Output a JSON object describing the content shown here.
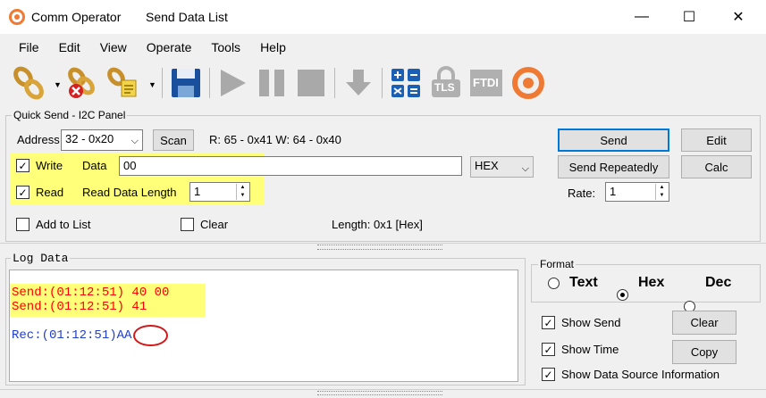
{
  "window": {
    "app_name": "Comm Operator",
    "document": "Send Data List",
    "minimize": "—",
    "maximize": "☐",
    "close": "✕"
  },
  "menu": [
    "File",
    "Edit",
    "View",
    "Operate",
    "Tools",
    "Help"
  ],
  "toolbar": {
    "icons": [
      "connect-icon",
      "disconnect-icon",
      "connection-settings-icon",
      "save-icon",
      "play-icon",
      "pause-icon",
      "stop-icon",
      "download-icon",
      "calculator-icon",
      "tls-icon",
      "ftdi-icon",
      "comm-operator-logo"
    ],
    "tls_label": "TLS",
    "ftdi_label": "FTDI"
  },
  "quick_send": {
    "title": "Quick Send - I2C Panel",
    "address_label": "Address",
    "address_value": "32 - 0x20",
    "scan_label": "Scan",
    "rw_info": "R: 65 - 0x41  W: 64 - 0x40",
    "write_label": "Write",
    "write_checked": true,
    "data_label": "Data",
    "data_value": "00",
    "format_value": "HEX",
    "read_label": "Read",
    "read_checked": true,
    "read_length_label": "Read Data Length",
    "read_length_value": "1",
    "add_to_list_label": "Add to List",
    "clear_label": "Clear",
    "length_info": "Length: 0x1 [Hex]",
    "send_label": "Send",
    "edit_label": "Edit",
    "send_repeatedly_label": "Send Repeatedly",
    "calc_label": "Calc",
    "rate_label": "Rate:",
    "rate_value": "1"
  },
  "log": {
    "title": "Log Data",
    "lines": [
      {
        "text": "Send:(01:12:51) 40 00",
        "color": "#ff0000"
      },
      {
        "text": "Send:(01:12:51) 41",
        "color": "#ff0000"
      }
    ],
    "rec_prefix": "Rec:(01:12:51)",
    "rec_value": "AA",
    "rec_color": "#1f3fcf"
  },
  "format": {
    "title": "Format",
    "options": [
      "Text",
      "Hex",
      "Dec"
    ],
    "selected": "Hex"
  },
  "options": {
    "show_send": "Show Send",
    "show_time": "Show Time",
    "show_source": "Show Data Source Information",
    "clear_button": "Clear",
    "copy_button": "Copy"
  },
  "colors": {
    "highlight": "#ffff7a",
    "accent": "#0078d7",
    "logo_orange": "#ef7a33"
  }
}
